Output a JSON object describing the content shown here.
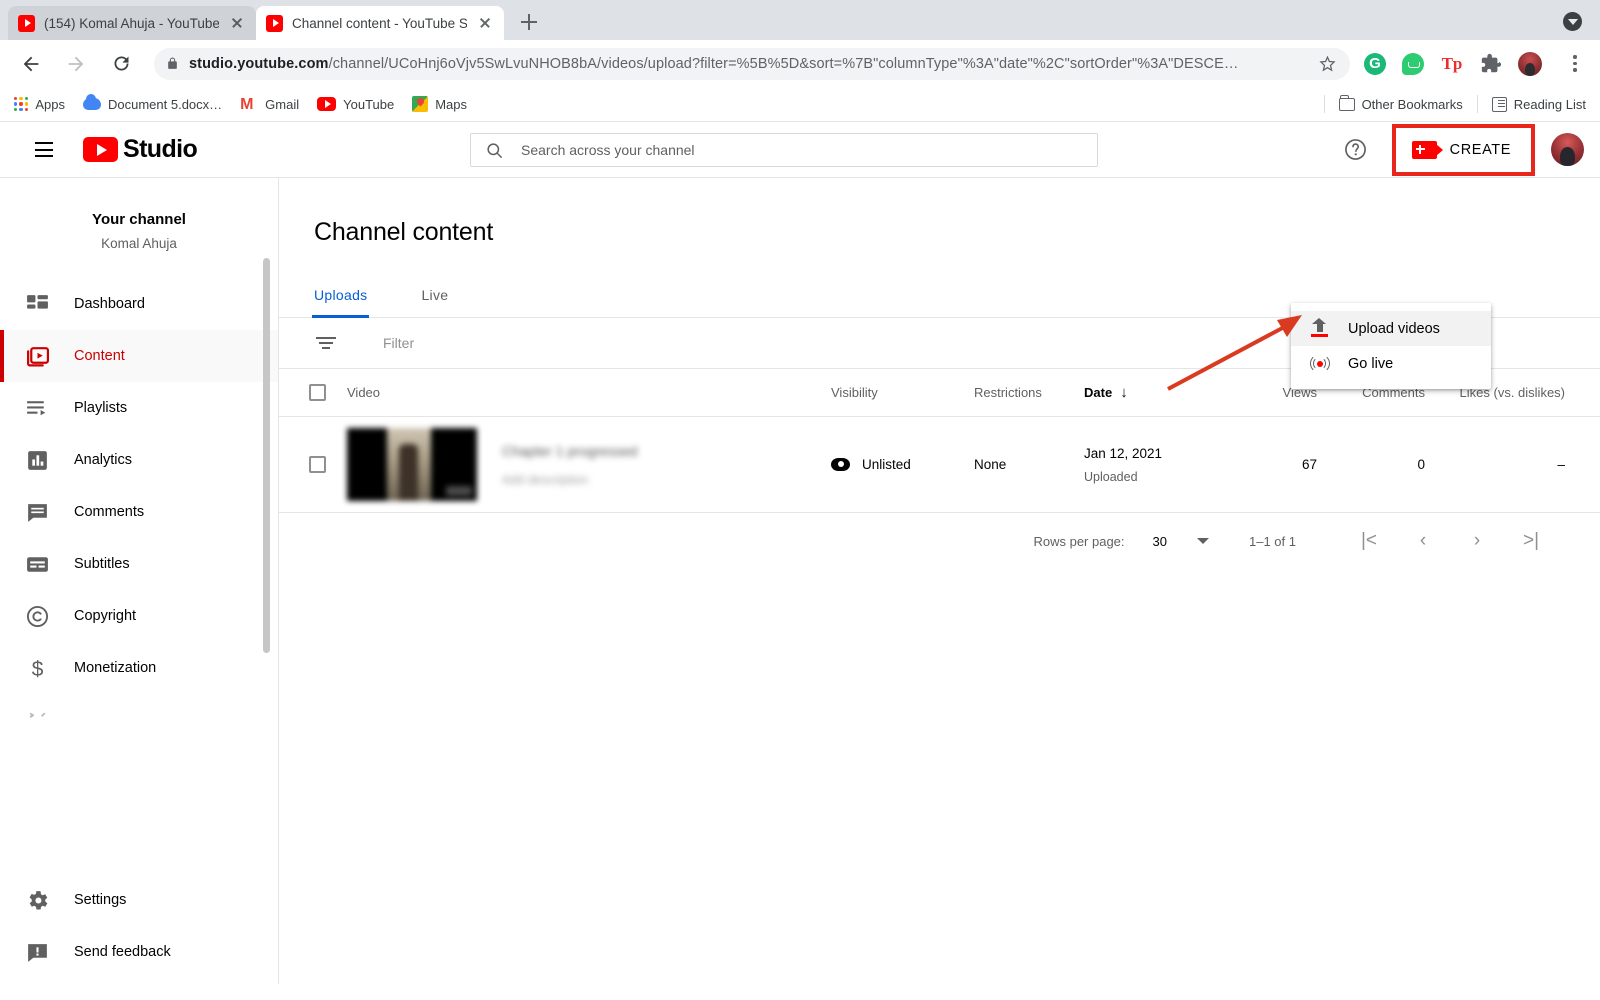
{
  "browser": {
    "tabs": [
      {
        "title": "(154) Komal Ahuja - YouTube",
        "active": false
      },
      {
        "title": "Channel content - YouTube Stu",
        "active": true
      }
    ],
    "newtab_label": "+",
    "url_prefix": "studio.youtube.com",
    "url_rest": "/channel/UCoHnj6oVjv5SwLvuNHOB8bA/videos/upload?filter=%5B%5D&sort=%7B\"columnType\"%3A\"date\"%2C\"sortOrder\"%3A\"DESCE…",
    "bookmarks": [
      {
        "label": "Apps",
        "icon": "apps-grid-icon"
      },
      {
        "label": "Document 5.docx…",
        "icon": "cloud-icon"
      },
      {
        "label": "Gmail",
        "icon": "gmail-icon"
      },
      {
        "label": "YouTube",
        "icon": "youtube-icon"
      },
      {
        "label": "Maps",
        "icon": "maps-icon"
      }
    ],
    "other_bookmarks": "Other Bookmarks",
    "reading_list": "Reading List"
  },
  "header": {
    "logo_text": "Studio",
    "search_placeholder": "Search across your channel",
    "search_value": "",
    "create_label": "CREATE"
  },
  "create_menu": {
    "items": [
      {
        "label": "Upload videos",
        "icon": "upload-icon",
        "hovered": true
      },
      {
        "label": "Go live",
        "icon": "broadcast-icon",
        "hovered": false
      }
    ]
  },
  "sidebar": {
    "channel_heading": "Your channel",
    "channel_name": "Komal Ahuja",
    "items": [
      {
        "label": "Dashboard",
        "icon": "dashboard-icon",
        "active": false
      },
      {
        "label": "Content",
        "icon": "content-icon",
        "active": true
      },
      {
        "label": "Playlists",
        "icon": "playlists-icon",
        "active": false
      },
      {
        "label": "Analytics",
        "icon": "analytics-icon",
        "active": false
      },
      {
        "label": "Comments",
        "icon": "comments-icon",
        "active": false
      },
      {
        "label": "Subtitles",
        "icon": "subtitles-icon",
        "active": false
      },
      {
        "label": "Copyright",
        "icon": "copyright-icon",
        "active": false
      },
      {
        "label": "Monetization",
        "icon": "monetization-icon",
        "active": false
      }
    ],
    "footer_items": [
      {
        "label": "Settings",
        "icon": "gear-icon"
      },
      {
        "label": "Send feedback",
        "icon": "feedback-icon"
      }
    ]
  },
  "main": {
    "page_title": "Channel content",
    "tabs": [
      {
        "label": "Uploads",
        "selected": true
      },
      {
        "label": "Live",
        "selected": false
      }
    ],
    "filter_placeholder": "Filter",
    "table": {
      "columns": [
        "Video",
        "Visibility",
        "Restrictions",
        "Date",
        "Views",
        "Comments",
        "Likes (vs. dislikes)"
      ],
      "sort_column": "Date",
      "sort_direction": "descending",
      "rows": [
        {
          "title": "Chapter 1 progressed",
          "description": "Add description",
          "visibility": "Unlisted",
          "restrictions": "None",
          "date": "Jan 12, 2021",
          "date_sub": "Uploaded",
          "views": "67",
          "comments": "0",
          "likes": "–"
        }
      ]
    },
    "pagination": {
      "rows_per_page_label": "Rows per page:",
      "rows_per_page_value": "30",
      "range": "1–1 of 1",
      "first_label": "|<",
      "prev_label": "‹",
      "next_label": "›",
      "last_label": ">|"
    }
  },
  "annotations": {
    "highlight_color": "#e8261b",
    "arrow_color": "#d93a20",
    "highlighted_target": "CREATE",
    "arrow_points_to": "Upload videos"
  }
}
